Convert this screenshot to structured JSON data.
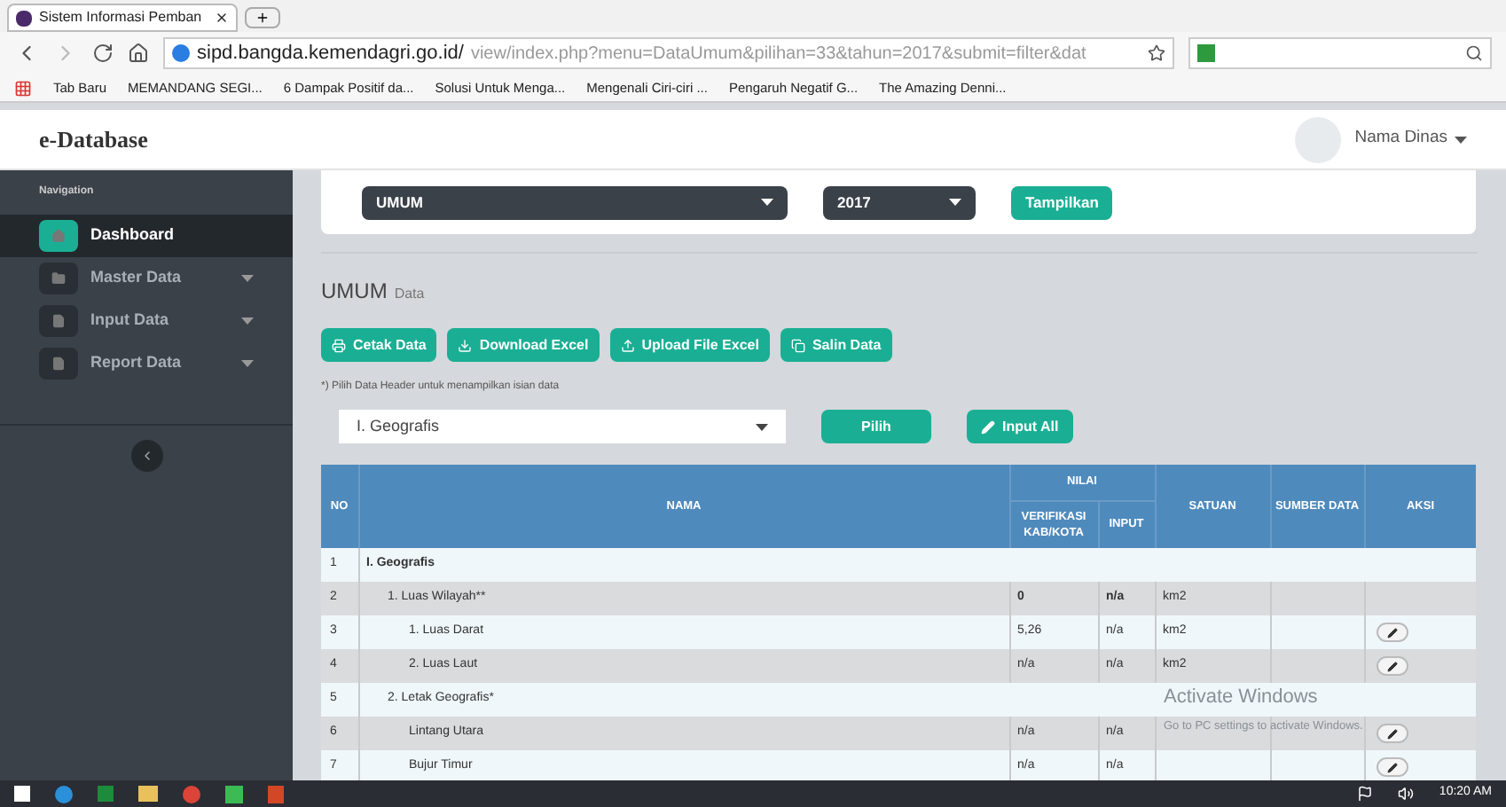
{
  "browser": {
    "tab_title": "Sistem Informasi Pemban",
    "url_host": "sipd.bangda.kemendagri.go.id/",
    "url_path": "view/index.php?menu=DataUmum&pilihan=33&tahun=2017&submit=filter&dat",
    "bookmarks": [
      "Tab Baru",
      "MEMANDANG SEGI...",
      "6 Dampak Positif da...",
      "Solusi Untuk Menga...",
      "Mengenali Ciri-ciri ...",
      "Pengaruh Negatif G...",
      "The Amazing Denni..."
    ]
  },
  "app": {
    "brand": "e-Database",
    "user": "Nama Dinas"
  },
  "sidebar": {
    "heading": "Navigation",
    "items": [
      {
        "label": "Dashboard",
        "selected": true,
        "submenu": false
      },
      {
        "label": "Master Data",
        "selected": false,
        "submenu": true
      },
      {
        "label": "Input Data",
        "selected": false,
        "submenu": true
      },
      {
        "label": "Report Data",
        "selected": false,
        "submenu": true
      }
    ]
  },
  "filters": {
    "category": "UMUM",
    "year": "2017",
    "button": "Tampilkan"
  },
  "page": {
    "title": "UMUM",
    "subtitle": "Data",
    "actions": [
      "Cetak Data",
      "Download Excel",
      "Upload File Excel",
      "Salin Data"
    ],
    "note": "*) Pilih Data Header untuk menampilkan isian data",
    "header_select": "I. Geografis",
    "choose_button": "Pilih",
    "input_all_button": "Input All"
  },
  "table": {
    "columns": {
      "no": "NO",
      "nama": "NAMA",
      "nilai": "NILAI",
      "verifikasi": "VERIFIKASI KAB/KOTA",
      "input": "INPUT",
      "satuan": "SATUAN",
      "sumber": "SUMBER DATA",
      "aksi": "AKSI"
    },
    "rows": [
      {
        "no": "1",
        "nama": "I. Geografis",
        "kind": "section",
        "children": [
          {
            "no": "2",
            "nama": "1. Luas Wilayah**",
            "kind": "total",
            "verifikasi": "0",
            "input": "n/a",
            "satuan": "km2",
            "children": [
              {
                "no": "3",
                "nama": "1. Luas Darat",
                "kind": "item",
                "verifikasi": "5,26",
                "input": "n/a",
                "satuan": "km2"
              },
              {
                "no": "4",
                "nama": "2. Luas Laut",
                "kind": "item",
                "verifikasi": "n/a",
                "input": "n/a",
                "satuan": "km2"
              }
            ]
          },
          {
            "no": "5",
            "nama": "2. Letak Geografis*",
            "kind": "heading",
            "children": [
              {
                "no": "6",
                "nama": "Lintang Utara",
                "kind": "item",
                "verifikasi": "n/a",
                "input": "n/a"
              },
              {
                "no": "7",
                "nama": "Bujur Timur",
                "kind": "item",
                "verifikasi": "n/a",
                "input": "n/a"
              }
            ]
          }
        ]
      }
    ]
  },
  "os": {
    "activation_title": "Activate Windows",
    "activation_hint": "Go to PC settings to activate Windows.",
    "clock": "10:20 AM"
  }
}
